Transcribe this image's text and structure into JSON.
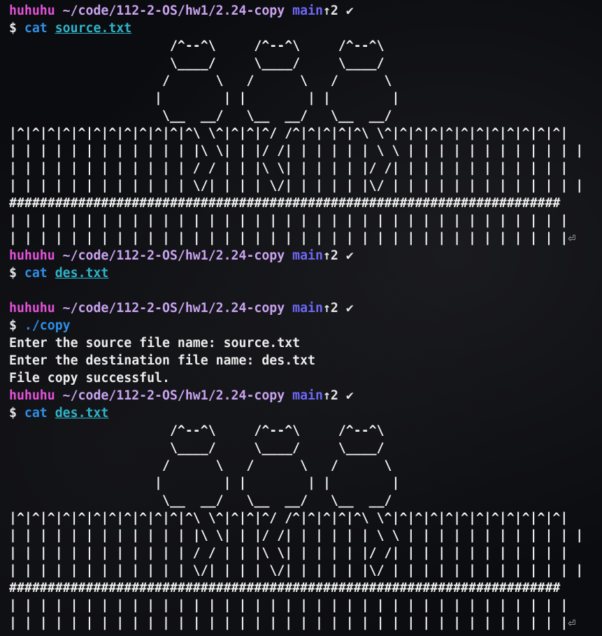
{
  "prompt": {
    "user": "huhuhu",
    "path": "~/code/112-2-OS/hw1/2.24-copy",
    "branch": "main",
    "ahead": "↑2",
    "status": "✔",
    "symbol": "$"
  },
  "ascii_art": [
    "                     /^--^\\     /^--^\\     /^--^\\",
    "                     \\____/     \\____/     \\____/",
    "                    /      \\   /      \\   /      \\",
    "                   |        | |        | |        |",
    "                    \\__  __/   \\__  __/   \\__  __/",
    "|^|^|^|^|^|^|^|^|^|^|^|^\\ \\^|^|^|^/ /^|^|^|^|^\\ \\^|^|^|^|^|^|^|^|^|^|^|^|",
    "| | | | | | | | | | | | |\\ \\| | |/ /| | | | | | \\ \\ | | | | | | | | | | | |",
    "| | | | | | | | | | | | / / | | |\\ \\| | | | | |/ /| | | | | | | | | | | |",
    "| | | | | | | | | | | | \\/| | | | \\/| | | | | |\\/ | | | | | | | | | | | | |",
    "########################################################################",
    "| | | | | | | | | | | | | | | | | | | | | | | | | | | | | | | | | | | | |",
    "| | | | | | | | | | | | | | | | | | | | | | | | | | | | | | | | | | | | |"
  ],
  "return_symbol": "⏎",
  "session": [
    {
      "cmd": "cat",
      "arg": "source.txt"
    },
    {
      "cmd": "cat",
      "arg": "des.txt"
    },
    {
      "cmd": "./copy",
      "arg": ""
    },
    {
      "cmd": "cat",
      "arg": "des.txt"
    }
  ],
  "copy_output": [
    "Enter the source file name: source.txt",
    "Enter the destination file name: des.txt",
    "File copy successful."
  ]
}
